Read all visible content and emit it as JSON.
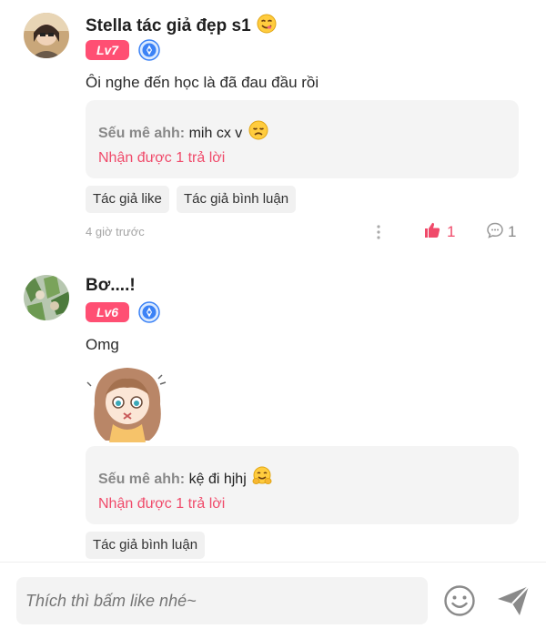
{
  "comments": [
    {
      "username": "Stella tác giả đẹp s1",
      "level": "Lv7",
      "text": "Ôi nghe đến học là đã đau đầu rồi",
      "reply": {
        "name": "Sếu mê ahh:",
        "text": "mih cx v"
      },
      "reply_count": "Nhận được 1 trả lời",
      "tags": [
        "Tác giả like",
        "Tác giả bình luận"
      ],
      "time": "4 giờ trước",
      "likes": "1",
      "comments": "1"
    },
    {
      "username": "Bơ....!",
      "level": "Lv6",
      "text": "Omg",
      "reply": {
        "name": "Sếu mê ahh:",
        "text": "kệ đi hjhj"
      },
      "reply_count": "Nhận được 1 trả lời",
      "tags": [
        "Tác giả bình luận"
      ]
    }
  ],
  "input": {
    "placeholder": "Thích thì bấm like nhé~"
  },
  "colors": {
    "accent": "#f04a6a",
    "badge": "#ff4f73",
    "vip": "#3b82f6"
  }
}
